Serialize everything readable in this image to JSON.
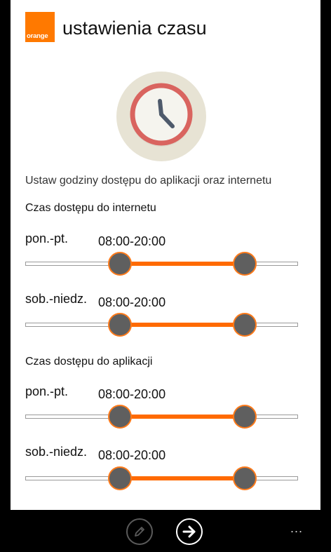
{
  "header": {
    "logo_text": "orange",
    "title": "ustawienia czasu"
  },
  "intro_text": "Ustaw godziny dostępu do aplikacji oraz internetu",
  "sections": [
    {
      "title": "Czas dostępu do internetu",
      "rows": [
        {
          "day": "pon.-pt.",
          "range": "08:00-20:00",
          "start_fraction": 0.346,
          "end_fraction": 0.805
        },
        {
          "day": "sob.-niedz.",
          "range": "08:00-20:00",
          "start_fraction": 0.346,
          "end_fraction": 0.805
        }
      ]
    },
    {
      "title": "Czas dostępu do aplikacji",
      "rows": [
        {
          "day": "pon.-pt.",
          "range": "08:00-20:00",
          "start_fraction": 0.346,
          "end_fraction": 0.805
        },
        {
          "day": "sob.-niedz.",
          "range": "08:00-20:00",
          "start_fraction": 0.346,
          "end_fraction": 0.805
        }
      ]
    }
  ],
  "app_bar": {
    "edit_icon": "pencil-icon",
    "next_icon": "arrow-right-icon",
    "more_label": "..."
  },
  "colors": {
    "brand": "#ff7900",
    "slider_fill": "#ff6a00",
    "thumb": "#5f5f5f",
    "clock_bg": "#e7e3d4",
    "clock_ring": "#d9645f",
    "clock_hands": "#4e5a6b"
  }
}
